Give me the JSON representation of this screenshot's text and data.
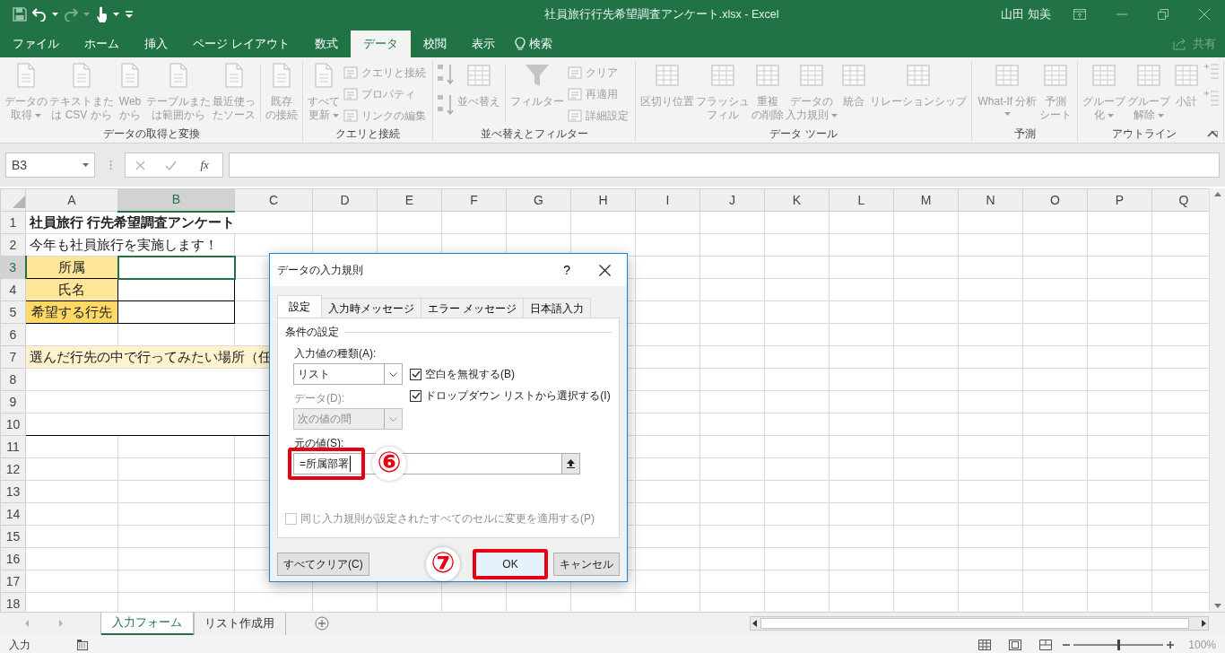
{
  "window": {
    "title": "社員旅行行先希望調査アンケート.xlsx  -  Excel",
    "user": "山田 知美"
  },
  "ribbon_tabs": [
    {
      "label": "ファイル",
      "selected": false
    },
    {
      "label": "ホーム",
      "selected": false
    },
    {
      "label": "挿入",
      "selected": false
    },
    {
      "label": "ページ レイアウト",
      "selected": false
    },
    {
      "label": "数式",
      "selected": false
    },
    {
      "label": "データ",
      "selected": true
    },
    {
      "label": "校閲",
      "selected": false
    },
    {
      "label": "表示",
      "selected": false
    }
  ],
  "search": {
    "label": "検索"
  },
  "share": {
    "label": "共有"
  },
  "ribbon": {
    "groups": [
      {
        "label": "データの取得と変換",
        "launcher": false,
        "buttons": [
          {
            "kind": "large",
            "lines": [
              "データの",
              "取得"
            ],
            "dropdown": true,
            "disabled": true
          },
          {
            "kind": "large",
            "lines": [
              "テキストまた",
              "は CSV から"
            ],
            "dropdown": false,
            "disabled": true
          },
          {
            "kind": "large",
            "lines": [
              "Web",
              "から"
            ],
            "dropdown": false,
            "disabled": true
          },
          {
            "kind": "large",
            "lines": [
              "テーブルまた",
              "は範囲から"
            ],
            "dropdown": false,
            "disabled": true
          },
          {
            "kind": "large",
            "lines": [
              "最近使っ",
              "たソース"
            ],
            "dropdown": false,
            "disabled": true
          },
          {
            "kind": "separator"
          },
          {
            "kind": "large",
            "lines": [
              "既存",
              "の接続"
            ],
            "dropdown": false,
            "disabled": true
          }
        ]
      },
      {
        "label": "クエリと接続",
        "launcher": false,
        "buttons": [
          {
            "kind": "large",
            "lines": [
              "すべて",
              "更新"
            ],
            "dropdown": true,
            "disabled": true
          },
          {
            "kind": "small",
            "label": "クエリと接続",
            "disabled": true
          },
          {
            "kind": "small",
            "label": "プロパティ",
            "disabled": true
          },
          {
            "kind": "small",
            "label": "リンクの編集",
            "disabled": true
          }
        ]
      },
      {
        "label": "並べ替えとフィルター",
        "launcher": false,
        "buttons": [
          {
            "kind": "icon",
            "disabled": true
          },
          {
            "kind": "icon",
            "disabled": true
          },
          {
            "kind": "large",
            "lines": [
              "並べ替え"
            ],
            "dropdown": false,
            "disabled": true
          },
          {
            "kind": "separator"
          },
          {
            "kind": "large",
            "lines": [
              "フィルター"
            ],
            "dropdown": false,
            "disabled": true
          },
          {
            "kind": "small",
            "label": "クリア",
            "disabled": true
          },
          {
            "kind": "small",
            "label": "再適用",
            "disabled": true
          },
          {
            "kind": "small",
            "label": "詳細設定",
            "disabled": true
          }
        ]
      },
      {
        "label": "データ ツール",
        "launcher": false,
        "buttons": [
          {
            "kind": "large",
            "lines": [
              "区切り位置"
            ],
            "dropdown": false,
            "disabled": true
          },
          {
            "kind": "large",
            "lines": [
              "フラッシュ",
              "フィル"
            ],
            "dropdown": false,
            "disabled": true
          },
          {
            "kind": "large",
            "lines": [
              "重複",
              "の削除"
            ],
            "dropdown": false,
            "disabled": true
          },
          {
            "kind": "large",
            "lines": [
              "データの",
              "入力規則"
            ],
            "dropdown": true,
            "disabled": true
          },
          {
            "kind": "large",
            "lines": [
              "統合"
            ],
            "dropdown": false,
            "disabled": true
          },
          {
            "kind": "large",
            "lines": [
              "リレーションシップ"
            ],
            "dropdown": false,
            "disabled": true
          }
        ]
      },
      {
        "label": "予測",
        "launcher": false,
        "buttons": [
          {
            "kind": "large",
            "lines": [
              "What-If 分析"
            ],
            "dropdown": true,
            "disabled": true
          },
          {
            "kind": "large",
            "lines": [
              "予測",
              "シート"
            ],
            "dropdown": false,
            "disabled": true
          }
        ]
      },
      {
        "label": "アウトライン",
        "launcher": true,
        "buttons": [
          {
            "kind": "large",
            "lines": [
              "グループ",
              "化"
            ],
            "dropdown": true,
            "disabled": true
          },
          {
            "kind": "large",
            "lines": [
              "グループ",
              "解除"
            ],
            "dropdown": true,
            "disabled": true
          },
          {
            "kind": "large",
            "lines": [
              "小計"
            ],
            "dropdown": false,
            "disabled": true
          },
          {
            "kind": "icon",
            "disabled": true
          },
          {
            "kind": "icon",
            "disabled": true
          }
        ]
      }
    ]
  },
  "formula_bar": {
    "name_box": "B3",
    "function_label": "fx"
  },
  "sheet": {
    "columns": [
      {
        "label": "A",
        "selected": false
      },
      {
        "label": "B",
        "selected": true
      },
      {
        "label": "C",
        "selected": false
      },
      {
        "label": "D",
        "selected": false
      },
      {
        "label": "E",
        "selected": false
      },
      {
        "label": "F",
        "selected": false
      },
      {
        "label": "G",
        "selected": false
      },
      {
        "label": "H",
        "selected": false
      },
      {
        "label": "I",
        "selected": false
      },
      {
        "label": "J",
        "selected": false
      },
      {
        "label": "K",
        "selected": false
      },
      {
        "label": "L",
        "selected": false
      },
      {
        "label": "M",
        "selected": false
      },
      {
        "label": "N",
        "selected": false
      },
      {
        "label": "O",
        "selected": false
      },
      {
        "label": "P",
        "selected": false
      },
      {
        "label": "Q",
        "selected": false
      }
    ],
    "rows": [
      {
        "number": "1",
        "selected": false,
        "kind": "title",
        "text": "社員旅行 行先希望調査アンケート"
      },
      {
        "number": "2",
        "selected": false,
        "kind": "note",
        "text": "今年も社員旅行を実施します！"
      },
      {
        "number": "3",
        "selected": true,
        "kind": "field",
        "text": "所属",
        "color": "#ffe699",
        "cell_selected": true
      },
      {
        "number": "4",
        "selected": false,
        "kind": "field",
        "text": "氏名",
        "color": "#ffe699",
        "cell_selected": false
      },
      {
        "number": "5",
        "selected": false,
        "kind": "field",
        "text": "希望する行先",
        "color": "#ffd966",
        "cell_selected": false
      },
      {
        "number": "6",
        "selected": false,
        "kind": "empty"
      },
      {
        "number": "7",
        "selected": false,
        "kind": "banner",
        "text": "選んだ行先の中で行ってみたい場所（任"
      },
      {
        "number": "8",
        "selected": false,
        "kind": "memo"
      },
      {
        "number": "9",
        "selected": false,
        "kind": "memo"
      },
      {
        "number": "10",
        "selected": false,
        "kind": "memoend"
      },
      {
        "number": "11",
        "selected": false,
        "kind": "empty"
      },
      {
        "number": "12",
        "selected": false,
        "kind": "empty"
      },
      {
        "number": "13",
        "selected": false,
        "kind": "empty"
      },
      {
        "number": "14",
        "selected": false,
        "kind": "empty"
      },
      {
        "number": "15",
        "selected": false,
        "kind": "empty"
      },
      {
        "number": "16",
        "selected": false,
        "kind": "empty"
      },
      {
        "number": "17",
        "selected": false,
        "kind": "empty"
      },
      {
        "number": "18",
        "selected": false,
        "kind": "empty"
      }
    ]
  },
  "dialog": {
    "title": "データの入力規則",
    "help": "?",
    "tabs": [
      {
        "label": "設定",
        "selected": true
      },
      {
        "label": "入力時メッセージ",
        "selected": false
      },
      {
        "label": "エラー メッセージ",
        "selected": false
      },
      {
        "label": "日本語入力",
        "selected": false
      }
    ],
    "section": "条件の設定",
    "allow": {
      "label": "入力値の種類(A):",
      "value": "リスト",
      "disabled": false
    },
    "options": [
      {
        "label": "空白を無視する(B)",
        "checked": true
      },
      {
        "label": "ドロップダウン リストから選択する(I)",
        "checked": true
      }
    ],
    "data": {
      "label": "データ(D):",
      "value": "次の値の間",
      "disabled": true
    },
    "source": {
      "label": "元の値(S):",
      "value": "=所属部署",
      "step": "⑥",
      "highlight": true
    },
    "apply_all": {
      "label": "同じ入力規則が設定されたすべてのセルに変更を適用する(P)",
      "checked": false,
      "disabled": true
    },
    "buttons": [
      {
        "label": "すべてクリア(C)",
        "default": false,
        "highlight": false
      },
      {
        "label": "OK",
        "default": true,
        "highlight": true,
        "step": "⑦"
      },
      {
        "label": "キャンセル",
        "default": false,
        "highlight": false
      }
    ]
  },
  "sheet_tabs": [
    {
      "label": "入力フォーム",
      "selected": true
    },
    {
      "label": "リスト作成用",
      "selected": false
    }
  ],
  "status_bar": {
    "mode": "入力",
    "zoom": {
      "level": 0.5,
      "reading": "100%"
    }
  }
}
